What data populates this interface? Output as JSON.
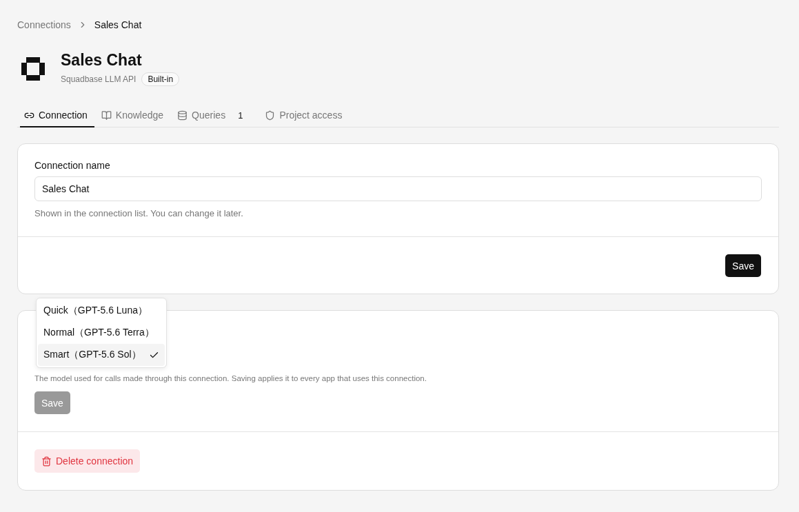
{
  "breadcrumb": [
    {
      "label": "Connections",
      "current": false
    },
    {
      "label": "Sales Chat",
      "current": true
    }
  ],
  "header": {
    "title": "Sales Chat",
    "subtitle": "Squadbase LLM API",
    "badge": "Built-in"
  },
  "tabs": [
    {
      "label": "Connection",
      "selected": true
    },
    {
      "label": "Knowledge",
      "selected": false
    },
    {
      "label": "Queries",
      "count": "1",
      "selected": false
    },
    {
      "label": "Project access",
      "selected": false
    }
  ],
  "name_card": {
    "label": "Connection name",
    "value": "Sales Chat",
    "help": "Shown in the connection list. You can change it later.",
    "save": {
      "label": "Save",
      "disabled": false
    }
  },
  "model_card": {
    "help": "The model used for calls made through this connection. Saving applies it to every app that uses this connection.",
    "save": {
      "label": "Save",
      "disabled": true
    },
    "delete": "Delete connection"
  },
  "model_menu": [
    {
      "label": "Quick（GPT-5.6 Luna）",
      "selected": false
    },
    {
      "label": "Normal（GPT-5.6 Terra）",
      "selected": false
    },
    {
      "label": "Smart（GPT-5.6 Sol）",
      "selected": true
    }
  ]
}
